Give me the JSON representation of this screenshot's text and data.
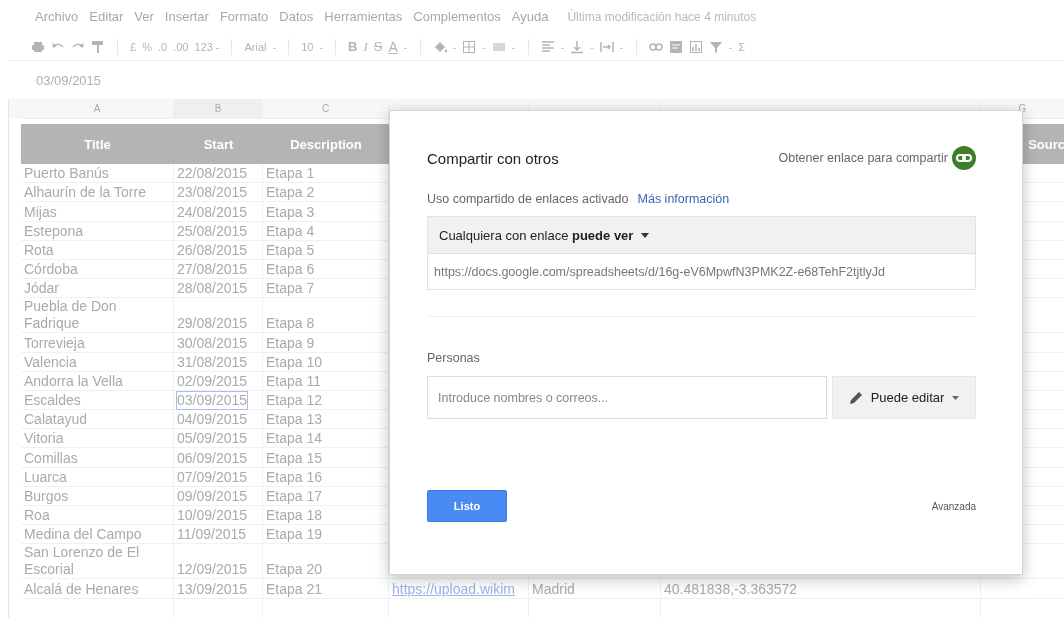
{
  "menu": [
    "Archivo",
    "Editar",
    "Ver",
    "Insertar",
    "Formato",
    "Datos",
    "Herramientas",
    "Complementos",
    "Ayuda"
  ],
  "last_modified": "Última modificación hace 4 minutos",
  "toolbar": [
    {
      "kind": "icon"
    },
    {
      "kind": "icon"
    },
    {
      "kind": "icon"
    },
    {
      "kind": "icon"
    },
    {
      "kind": "separator"
    },
    {
      "kind": "text",
      "label": "£"
    },
    {
      "kind": "text",
      "label": "%"
    },
    {
      "kind": "text",
      "label": ".0"
    },
    {
      "kind": "text",
      "label": ".00"
    },
    {
      "kind": "text",
      "label": "123 -"
    },
    {
      "kind": "separator"
    },
    {
      "kind": "text",
      "label": "Arial"
    },
    {
      "kind": "caret",
      "label": "-"
    },
    {
      "kind": "separator"
    },
    {
      "kind": "text",
      "label": "10"
    },
    {
      "kind": "caret",
      "label": "-"
    },
    {
      "kind": "separator"
    },
    {
      "kind": "bold",
      "label": "B"
    },
    {
      "kind": "italic",
      "label": "I"
    },
    {
      "kind": "strike",
      "label": "S"
    },
    {
      "kind": "underline",
      "label": "A"
    },
    {
      "kind": "caret",
      "label": "-"
    },
    {
      "kind": "separator"
    },
    {
      "kind": "icon"
    },
    {
      "kind": "caret",
      "label": "-"
    },
    {
      "kind": "icon"
    },
    {
      "kind": "caret",
      "label": "-"
    },
    {
      "kind": "icon"
    },
    {
      "kind": "caret",
      "label": "-"
    },
    {
      "kind": "separator"
    },
    {
      "kind": "icon"
    },
    {
      "kind": "caret",
      "label": "-"
    },
    {
      "kind": "icon"
    },
    {
      "kind": "caret",
      "label": "-"
    },
    {
      "kind": "icon"
    },
    {
      "kind": "caret",
      "label": "-"
    },
    {
      "kind": "separator"
    },
    {
      "kind": "icon"
    },
    {
      "kind": "icon"
    },
    {
      "kind": "icon"
    },
    {
      "kind": "icon"
    },
    {
      "kind": "caret",
      "label": "-"
    },
    {
      "kind": "text",
      "label": "Σ"
    }
  ],
  "formula_bar": {
    "value": "03/09/2015"
  },
  "columns": [
    {
      "letter": "A",
      "heading": "Title"
    },
    {
      "letter": "B",
      "heading": "Start"
    },
    {
      "letter": "C",
      "heading": "Description"
    }
  ],
  "right_column": {
    "letter": "G",
    "heading": "Sourc"
  },
  "rows": [
    {
      "title": "Puerto Banús",
      "start": "22/08/2015",
      "description": "Etapa 1",
      "selected": false
    },
    {
      "title": "Alhaurín de la Torre",
      "start": "23/08/2015",
      "description": "Etapa 2",
      "selected": false
    },
    {
      "title": "Mijas",
      "start": "24/08/2015",
      "description": "Etapa 3",
      "selected": false
    },
    {
      "title": "Estepona",
      "start": "25/08/2015",
      "description": "Etapa 4",
      "selected": false
    },
    {
      "title": "Rota",
      "start": "26/08/2015",
      "description": "Etapa 5",
      "selected": false
    },
    {
      "title": "Córdoba",
      "start": "27/08/2015",
      "description": "Etapa 6",
      "selected": false
    },
    {
      "title": "Jódar",
      "start": "28/08/2015",
      "description": "Etapa 7",
      "selected": false
    },
    {
      "title": "Puebla de Don Fadrique",
      "start": "29/08/2015",
      "description": "Etapa 8",
      "selected": false
    },
    {
      "title": "Torrevieja",
      "start": "30/08/2015",
      "description": "Etapa 9",
      "selected": false
    },
    {
      "title": "Valencia",
      "start": "31/08/2015",
      "description": "Etapa 10",
      "selected": false
    },
    {
      "title": "Andorra la Vella",
      "start": "02/09/2015",
      "description": "Etapa 11",
      "selected": false
    },
    {
      "title": "Escaldes",
      "start": "03/09/2015",
      "description": "Etapa 12",
      "selected": true
    },
    {
      "title": "Calatayud",
      "start": "04/09/2015",
      "description": "Etapa 13",
      "selected": false
    },
    {
      "title": "Vitoria",
      "start": "05/09/2015",
      "description": "Etapa 14",
      "selected": false
    },
    {
      "title": "Comillas",
      "start": "06/09/2015",
      "description": "Etapa 15",
      "selected": false
    },
    {
      "title": "Luarca",
      "start": "07/09/2015",
      "description": "Etapa 16",
      "selected": false
    },
    {
      "title": "Burgos",
      "start": "09/09/2015",
      "description": "Etapa 17",
      "selected": false
    },
    {
      "title": "Roa",
      "start": "10/09/2015",
      "description": "Etapa 18",
      "selected": false
    },
    {
      "title": "Medina del Campo",
      "start": "11/09/2015",
      "description": "Etapa 19",
      "selected": false
    },
    {
      "title": "San Lorenzo de El Escorial",
      "start": "12/09/2015",
      "description": "Etapa 20",
      "selected": false
    },
    {
      "title": "Alcalá de Henares",
      "start": "13/09/2015",
      "description": "Etapa 21",
      "selected": false,
      "column_4": "https://upload.wikim",
      "column_5": "Madrid",
      "column_6": "40.481838,-3.363572"
    }
  ],
  "dialog": {
    "title": "Compartir con otros",
    "get_link": "Obtener enlace para compartir",
    "link_sharing_status": "Uso compartido de enlaces activado",
    "more_info_link": "Más información",
    "access_dropdown": "Cualquiera con enlace **puede ver**",
    "share_url": "https://docs.google.com/spreadsheets/d/16g-eV6MpwfN3PMK2Z-e68TehF2tjtlyJd",
    "people_label": "Personas",
    "people_field": {
      "placeholder": "Introduce nombres o correos..."
    },
    "permission_button": "Puede editar",
    "done_button": "Listo",
    "advanced_link": "Avanzada"
  }
}
